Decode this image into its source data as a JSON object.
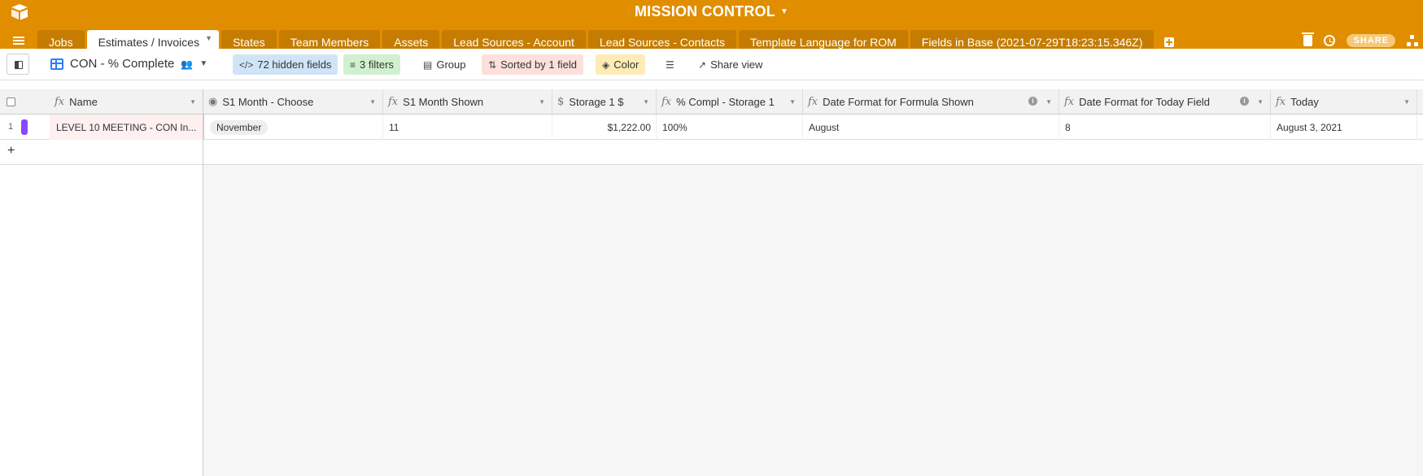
{
  "app": {
    "title": "MISSION CONTROL"
  },
  "tabs": [
    {
      "label": "Jobs"
    },
    {
      "label": "Estimates / Invoices"
    },
    {
      "label": "States"
    },
    {
      "label": "Team Members"
    },
    {
      "label": "Assets"
    },
    {
      "label": "Lead Sources - Account"
    },
    {
      "label": "Lead Sources - Contacts"
    },
    {
      "label": "Template Language for ROM"
    },
    {
      "label": "Fields in Base (2021-07-29T18:23:15.346Z)"
    }
  ],
  "active_tab": "Estimates / Invoices",
  "header_tools": {
    "share_label": "SHARE"
  },
  "view": {
    "name": "CON - % Complete",
    "hidden_fields": "72 hidden fields",
    "filters": "3 filters",
    "group": "Group",
    "sort": "Sorted by 1 field",
    "color": "Color",
    "share_view": "Share view"
  },
  "columns": [
    {
      "label": "Name",
      "type_icon": "fx"
    },
    {
      "label": "S1 Month - Choose",
      "type_icon": "single-select"
    },
    {
      "label": "S1 Month Shown",
      "type_icon": "fx"
    },
    {
      "label": "Storage 1 $",
      "type_icon": "currency"
    },
    {
      "label": "% Compl - Storage 1",
      "type_icon": "fx"
    },
    {
      "label": "Date Format for Formula Shown",
      "type_icon": "fx"
    },
    {
      "label": "Date Format for Today Field",
      "type_icon": "fx"
    },
    {
      "label": "Today",
      "type_icon": "fx"
    }
  ],
  "rows": [
    {
      "num": "1",
      "name": "LEVEL 10 MEETING - CON In...",
      "s1_month_choose": "November",
      "s1_month_shown": "11",
      "storage_1": "$1,222.00",
      "pct_compl": "100%",
      "date_format_formula": "August",
      "date_format_today": "8",
      "today": "August 3, 2021"
    }
  ],
  "colors": {
    "header_bg": "#e08d00",
    "tab_bg": "#c57c00",
    "row_color_bar": "#8b46ff",
    "hidden_fields_bg": "#cfe5f7",
    "filters_bg": "#d1f0cf",
    "sort_bg": "#fde0dc",
    "color_bg": "#ffebb5"
  }
}
